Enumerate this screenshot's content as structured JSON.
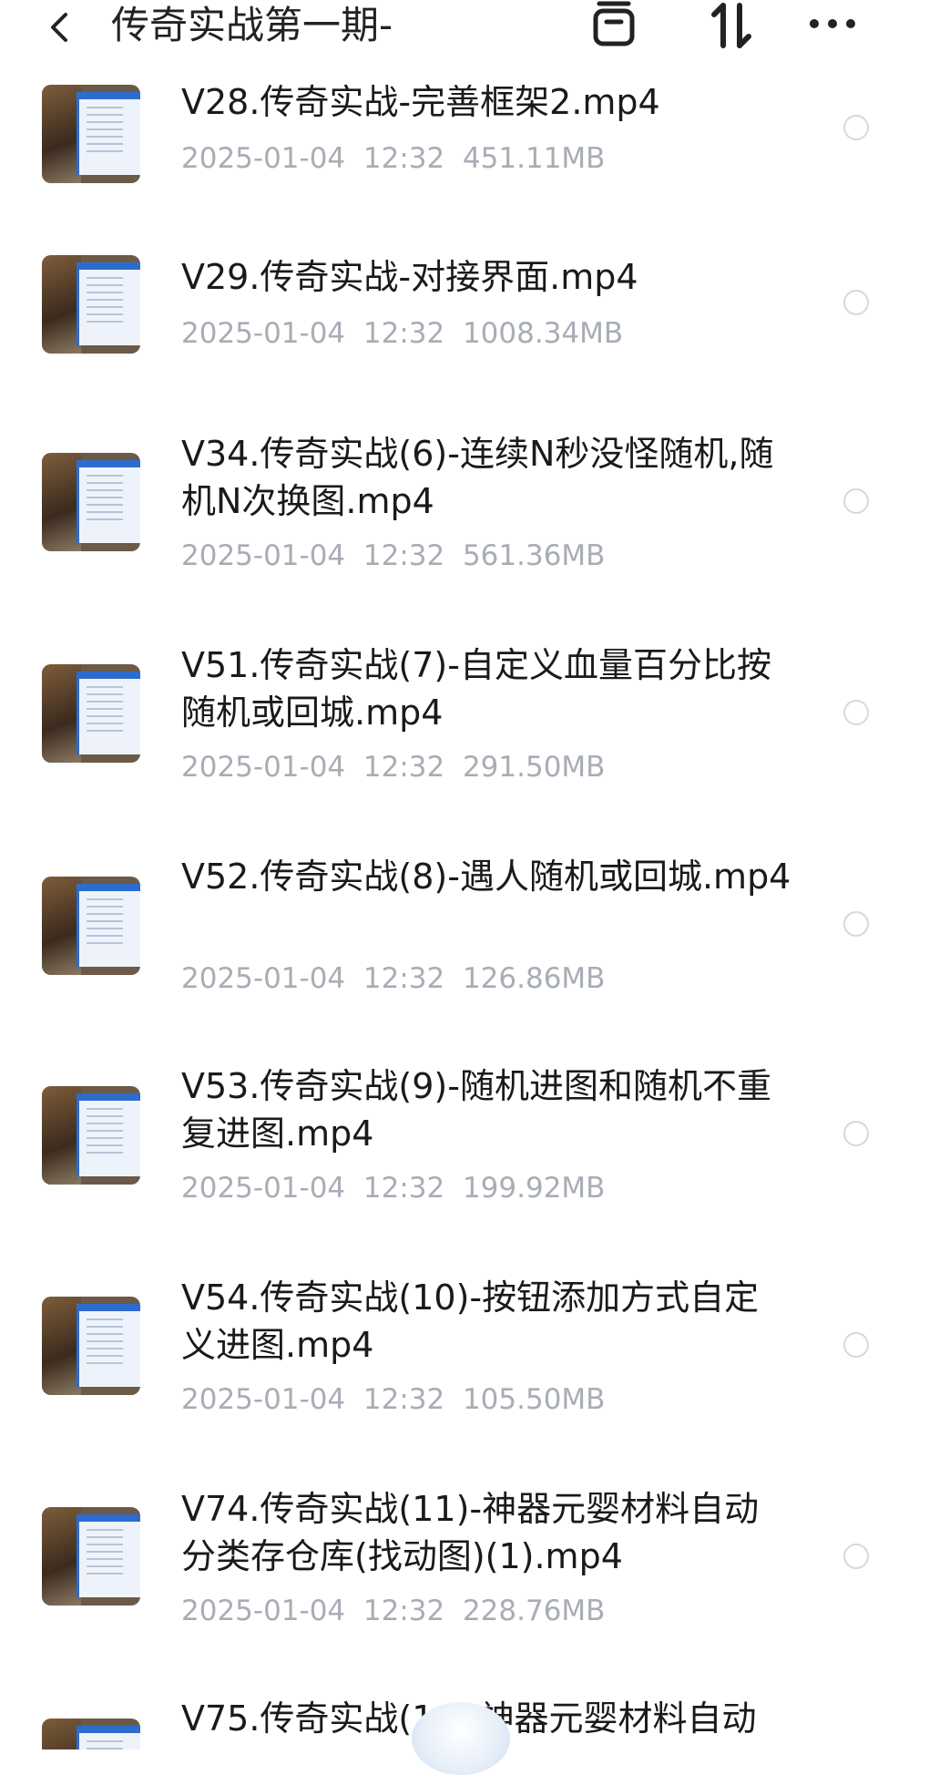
{
  "header": {
    "title": "传奇实战第一期-"
  },
  "files": [
    {
      "name": "V28.传奇实战-完善框架2.mp4",
      "date": "2025-01-04",
      "time": "12:32",
      "size": "451.11MB"
    },
    {
      "name": "V29.传奇实战-对接界面.mp4",
      "date": "2025-01-04",
      "time": "12:32",
      "size": "1008.34MB"
    },
    {
      "name": "V34.传奇实战(6)-连续N秒没怪随机,随机N次换图.mp4",
      "date": "2025-01-04",
      "time": "12:32",
      "size": "561.36MB"
    },
    {
      "name": "V51.传奇实战(7)-自定义血量百分比按随机或回城.mp4",
      "date": "2025-01-04",
      "time": "12:32",
      "size": "291.50MB"
    },
    {
      "name": "V52.传奇实战(8)-遇人随机或回城.mp4",
      "date": "2025-01-04",
      "time": "12:32",
      "size": "126.86MB"
    },
    {
      "name": "V53.传奇实战(9)-随机进图和随机不重复进图.mp4",
      "date": "2025-01-04",
      "time": "12:32",
      "size": "199.92MB"
    },
    {
      "name": "V54.传奇实战(10)-按钮添加方式自定义进图.mp4",
      "date": "2025-01-04",
      "time": "12:32",
      "size": "105.50MB"
    },
    {
      "name": "V74.传奇实战(11)-神器元婴材料自动分类存仓库(找动图)(1).mp4",
      "date": "2025-01-04",
      "time": "12:32",
      "size": "228.76MB"
    },
    {
      "name": "V75.传奇实战(1… 神器元婴材料自动",
      "date": "",
      "time": "",
      "size": ""
    }
  ]
}
